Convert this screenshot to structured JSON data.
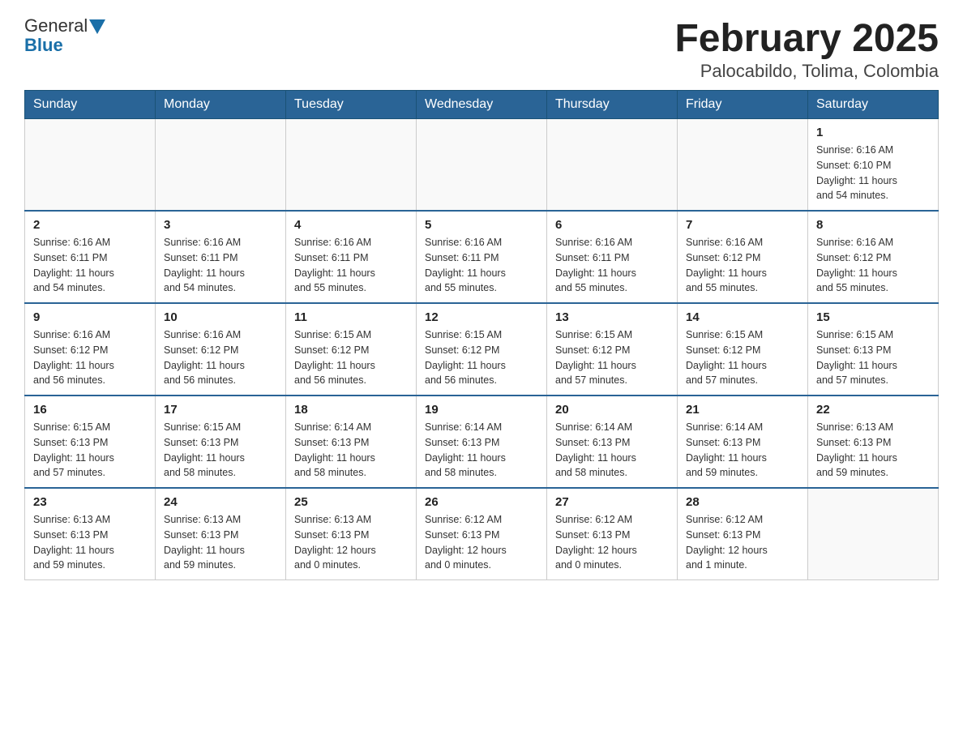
{
  "logo": {
    "text_general": "General",
    "text_blue": "Blue"
  },
  "title": "February 2025",
  "subtitle": "Palocabildo, Tolima, Colombia",
  "weekdays": [
    "Sunday",
    "Monday",
    "Tuesday",
    "Wednesday",
    "Thursday",
    "Friday",
    "Saturday"
  ],
  "weeks": [
    [
      {
        "day": "",
        "info": ""
      },
      {
        "day": "",
        "info": ""
      },
      {
        "day": "",
        "info": ""
      },
      {
        "day": "",
        "info": ""
      },
      {
        "day": "",
        "info": ""
      },
      {
        "day": "",
        "info": ""
      },
      {
        "day": "1",
        "info": "Sunrise: 6:16 AM\nSunset: 6:10 PM\nDaylight: 11 hours\nand 54 minutes."
      }
    ],
    [
      {
        "day": "2",
        "info": "Sunrise: 6:16 AM\nSunset: 6:11 PM\nDaylight: 11 hours\nand 54 minutes."
      },
      {
        "day": "3",
        "info": "Sunrise: 6:16 AM\nSunset: 6:11 PM\nDaylight: 11 hours\nand 54 minutes."
      },
      {
        "day": "4",
        "info": "Sunrise: 6:16 AM\nSunset: 6:11 PM\nDaylight: 11 hours\nand 55 minutes."
      },
      {
        "day": "5",
        "info": "Sunrise: 6:16 AM\nSunset: 6:11 PM\nDaylight: 11 hours\nand 55 minutes."
      },
      {
        "day": "6",
        "info": "Sunrise: 6:16 AM\nSunset: 6:11 PM\nDaylight: 11 hours\nand 55 minutes."
      },
      {
        "day": "7",
        "info": "Sunrise: 6:16 AM\nSunset: 6:12 PM\nDaylight: 11 hours\nand 55 minutes."
      },
      {
        "day": "8",
        "info": "Sunrise: 6:16 AM\nSunset: 6:12 PM\nDaylight: 11 hours\nand 55 minutes."
      }
    ],
    [
      {
        "day": "9",
        "info": "Sunrise: 6:16 AM\nSunset: 6:12 PM\nDaylight: 11 hours\nand 56 minutes."
      },
      {
        "day": "10",
        "info": "Sunrise: 6:16 AM\nSunset: 6:12 PM\nDaylight: 11 hours\nand 56 minutes."
      },
      {
        "day": "11",
        "info": "Sunrise: 6:15 AM\nSunset: 6:12 PM\nDaylight: 11 hours\nand 56 minutes."
      },
      {
        "day": "12",
        "info": "Sunrise: 6:15 AM\nSunset: 6:12 PM\nDaylight: 11 hours\nand 56 minutes."
      },
      {
        "day": "13",
        "info": "Sunrise: 6:15 AM\nSunset: 6:12 PM\nDaylight: 11 hours\nand 57 minutes."
      },
      {
        "day": "14",
        "info": "Sunrise: 6:15 AM\nSunset: 6:12 PM\nDaylight: 11 hours\nand 57 minutes."
      },
      {
        "day": "15",
        "info": "Sunrise: 6:15 AM\nSunset: 6:13 PM\nDaylight: 11 hours\nand 57 minutes."
      }
    ],
    [
      {
        "day": "16",
        "info": "Sunrise: 6:15 AM\nSunset: 6:13 PM\nDaylight: 11 hours\nand 57 minutes."
      },
      {
        "day": "17",
        "info": "Sunrise: 6:15 AM\nSunset: 6:13 PM\nDaylight: 11 hours\nand 58 minutes."
      },
      {
        "day": "18",
        "info": "Sunrise: 6:14 AM\nSunset: 6:13 PM\nDaylight: 11 hours\nand 58 minutes."
      },
      {
        "day": "19",
        "info": "Sunrise: 6:14 AM\nSunset: 6:13 PM\nDaylight: 11 hours\nand 58 minutes."
      },
      {
        "day": "20",
        "info": "Sunrise: 6:14 AM\nSunset: 6:13 PM\nDaylight: 11 hours\nand 58 minutes."
      },
      {
        "day": "21",
        "info": "Sunrise: 6:14 AM\nSunset: 6:13 PM\nDaylight: 11 hours\nand 59 minutes."
      },
      {
        "day": "22",
        "info": "Sunrise: 6:13 AM\nSunset: 6:13 PM\nDaylight: 11 hours\nand 59 minutes."
      }
    ],
    [
      {
        "day": "23",
        "info": "Sunrise: 6:13 AM\nSunset: 6:13 PM\nDaylight: 11 hours\nand 59 minutes."
      },
      {
        "day": "24",
        "info": "Sunrise: 6:13 AM\nSunset: 6:13 PM\nDaylight: 11 hours\nand 59 minutes."
      },
      {
        "day": "25",
        "info": "Sunrise: 6:13 AM\nSunset: 6:13 PM\nDaylight: 12 hours\nand 0 minutes."
      },
      {
        "day": "26",
        "info": "Sunrise: 6:12 AM\nSunset: 6:13 PM\nDaylight: 12 hours\nand 0 minutes."
      },
      {
        "day": "27",
        "info": "Sunrise: 6:12 AM\nSunset: 6:13 PM\nDaylight: 12 hours\nand 0 minutes."
      },
      {
        "day": "28",
        "info": "Sunrise: 6:12 AM\nSunset: 6:13 PM\nDaylight: 12 hours\nand 1 minute."
      },
      {
        "day": "",
        "info": ""
      }
    ]
  ]
}
